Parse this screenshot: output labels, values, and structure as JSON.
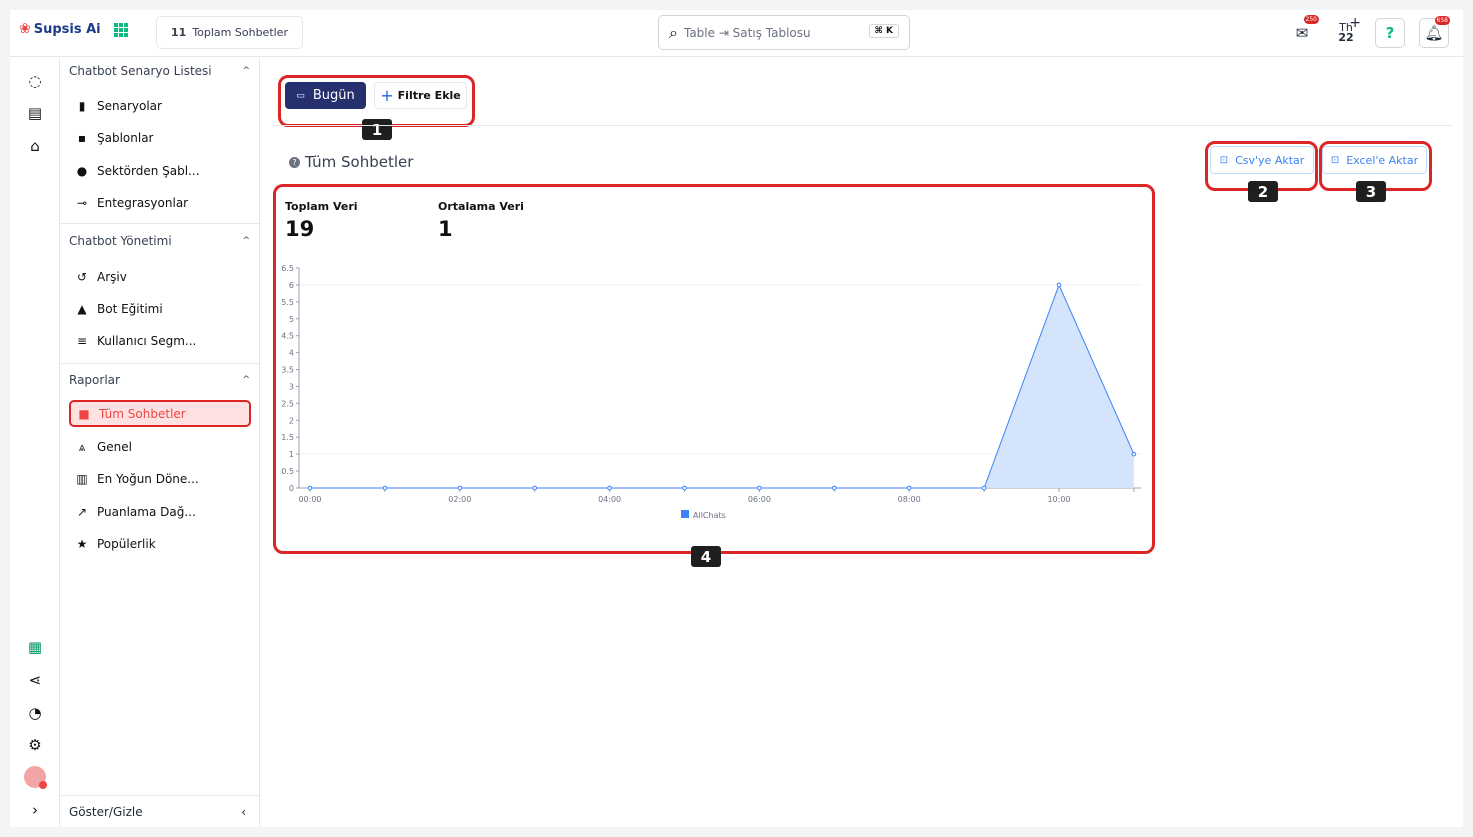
{
  "brand": {
    "name": "Supsis Ai"
  },
  "breadcrumb": {
    "icon": "11",
    "label": "Toplam Sohbetler"
  },
  "search": {
    "placeholder": "Table ⇥ Satış Tablosu",
    "shortcut": "⌘ K"
  },
  "header_icons": [
    {
      "name": "mail-icon",
      "badge": "250"
    },
    {
      "name": "date-icon",
      "day": "Th",
      "date": "22"
    },
    {
      "name": "help-icon"
    },
    {
      "name": "bell-icon",
      "badge": "658"
    }
  ],
  "sidebar": {
    "sections": [
      {
        "title": "Chatbot Senaryo Listesi",
        "items": [
          "Senaryolar",
          "Şablonlar",
          "Sektörden Şabl...",
          "Entegrasyonlar"
        ]
      },
      {
        "title": "Chatbot Yönetimi",
        "items": [
          "Arşiv",
          "Bot Eğitimi",
          "Kullanıcı Segm..."
        ]
      },
      {
        "title": "Raporlar",
        "items": [
          "Tüm Sohbetler",
          "Genel",
          "En Yoğun Döne...",
          "Puanlama Dağ...",
          "Popülerlik"
        ]
      }
    ],
    "toggle_label": "Göster/Gizle"
  },
  "toolbar": {
    "today_label": "Bugün",
    "filter_label": "Filtre Ekle"
  },
  "page": {
    "title": "Tüm Sohbetler"
  },
  "export": {
    "csv_label": "Csv'ye Aktar",
    "excel_label": "Excel'e Aktar"
  },
  "stats": {
    "total_label": "Toplam Veri",
    "total_value": "19",
    "avg_label": "Ortalama Veri",
    "avg_value": "1"
  },
  "annotations": [
    "1",
    "2",
    "3",
    "4"
  ],
  "chart_data": {
    "type": "area",
    "x": [
      "00:00",
      "01:00",
      "02:00",
      "03:00",
      "04:00",
      "05:00",
      "06:00",
      "07:00",
      "08:00",
      "09:00",
      "10:00",
      "11:00"
    ],
    "x_tick_labels": [
      "00:00",
      "02:00",
      "04:00",
      "06:00",
      "08:00",
      "10:00"
    ],
    "series": [
      {
        "name": "AllChats",
        "values": [
          0,
          0,
          0,
          0,
          0,
          0,
          0,
          0,
          0,
          0,
          6,
          1
        ],
        "color": "#3b82f6"
      }
    ],
    "ylim": [
      0,
      6.5
    ],
    "y_ticks": [
      "0",
      "0.5",
      "1",
      "1.5",
      "2",
      "2.5",
      "3",
      "3.5",
      "4",
      "4.5",
      "5",
      "5.5",
      "6",
      "6.5"
    ],
    "legend": "bottom",
    "grid": "horizontal"
  },
  "colors": {
    "accent": "#26306e",
    "highlight": "#dc2626",
    "active_bg": "#fee2e2",
    "series": "#3b82f6"
  }
}
